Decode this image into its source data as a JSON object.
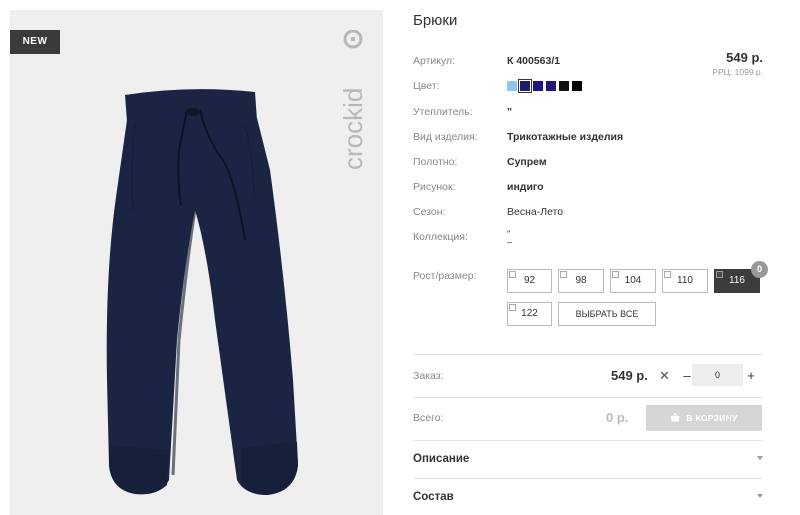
{
  "product": {
    "badge": "NEW",
    "brand": "crockid",
    "title": "Брюки"
  },
  "attributes": {
    "article": {
      "label": "Артикул:",
      "value": "К 400563/1"
    },
    "color": {
      "label": "Цвет:"
    },
    "insulation": {
      "label": "Утеплитель:",
      "value": "\""
    },
    "item_type": {
      "label": "Вид изделия:",
      "value": "Трикотажные изделия"
    },
    "fabric": {
      "label": "Полотно:",
      "value": "Супрем"
    },
    "pattern": {
      "label": "Рисунок:",
      "value": "индиго"
    },
    "season": {
      "label": "Сезон:",
      "value": "Весна-Лето"
    },
    "collection": {
      "label": "Коллекция:",
      "value_line1": "\"",
      "value_line2": "–"
    },
    "size_label": "Рост/размер:"
  },
  "price": {
    "value": "549 р.",
    "rrp": "РРЦ: 1099 р."
  },
  "swatches": [
    {
      "color": "#8dc6f0",
      "selected": false
    },
    {
      "color": "#1a1f6b",
      "selected": true
    },
    {
      "color": "#1c1680",
      "selected": false
    },
    {
      "color": "#231580",
      "selected": false
    },
    {
      "color": "#111111",
      "selected": false
    },
    {
      "color": "#000000",
      "selected": false
    }
  ],
  "sizes": {
    "items": [
      "92",
      "98",
      "104",
      "110",
      "116",
      "122"
    ],
    "active": "116",
    "active_count": "0",
    "select_all": "ВЫБРАТЬ ВСЕ"
  },
  "order": {
    "label": "Заказ:",
    "price": "549 р.",
    "times": "✕",
    "minus": "–",
    "plus": "+",
    "quantity": "0"
  },
  "total": {
    "label": "Всего:",
    "sum": "0 р.",
    "cart_button": "В КОРЗИНУ"
  },
  "accordions": {
    "description": "Описание",
    "composition": "Состав"
  },
  "colors": {
    "pants": "#1b2543",
    "pants_shadow": "#131a30",
    "image_bg": "#efefef",
    "badge_bg": "#3a3a3a",
    "logo": "#b8b8b8"
  },
  "icons": {
    "cart": "shopping-basket-icon",
    "expand": "chevron-down-icon"
  }
}
